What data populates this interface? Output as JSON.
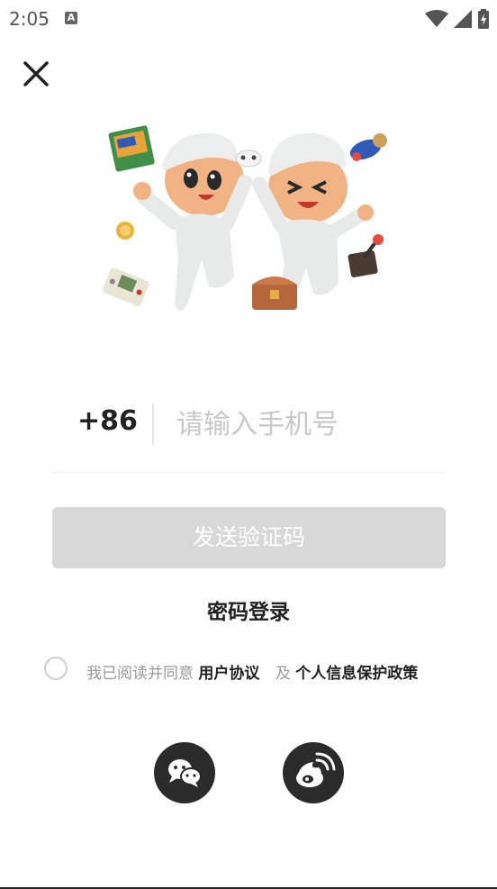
{
  "status_bar": {
    "time": "2:05",
    "notification_badge": "A",
    "icons": [
      "wifi-icon",
      "signal-icon",
      "battery-icon"
    ]
  },
  "close": {
    "icon": "close-icon"
  },
  "hero": {
    "description_icon": "mascot-illustration"
  },
  "phone": {
    "country_code": "+86",
    "placeholder": "请输入手机号",
    "value": ""
  },
  "send_code": {
    "label": "发送验证码"
  },
  "password_login": {
    "label": "密码登录"
  },
  "agreement": {
    "prefix": "我已阅读并同意",
    "user_agreement": "用户协议",
    "and": "及",
    "privacy_policy": "个人信息保护政策",
    "checked": false
  },
  "social": [
    {
      "name": "wechat",
      "icon": "wechat-icon"
    },
    {
      "name": "weibo",
      "icon": "weibo-icon"
    }
  ],
  "colors": {
    "button_disabled": "#d8d8d8",
    "social_bg": "#2b2b2b",
    "placeholder": "#c8c8c8",
    "muted_text": "#9a9a9a"
  }
}
